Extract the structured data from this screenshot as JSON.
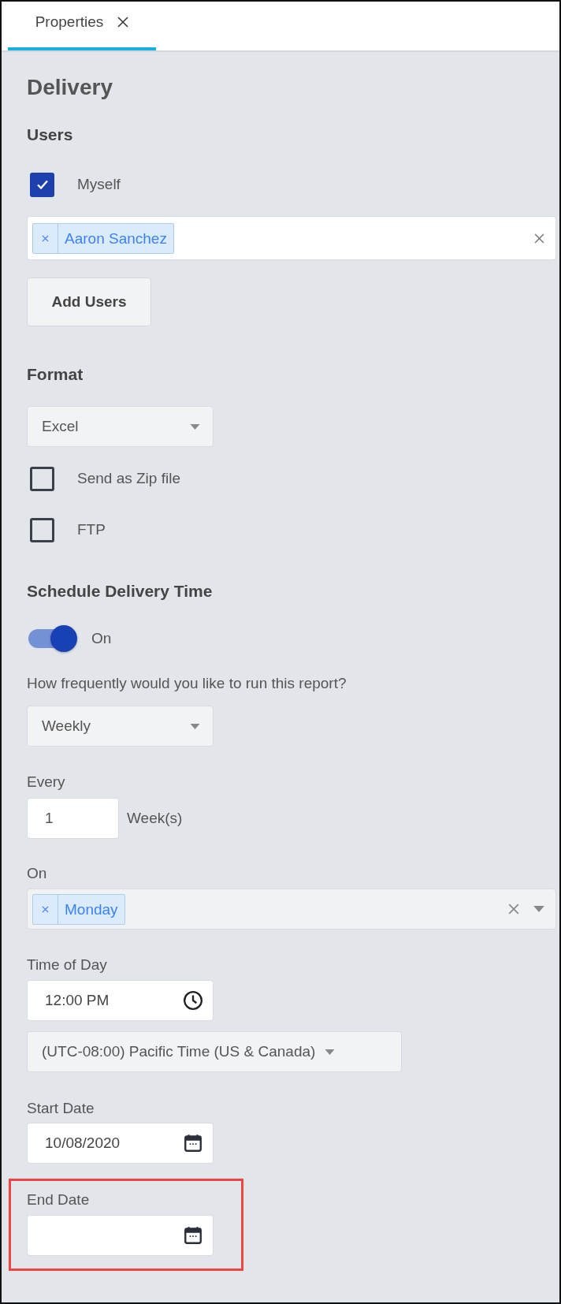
{
  "tabs": [
    {
      "label": "Properties",
      "selected": true
    }
  ],
  "title": "Delivery",
  "users": {
    "heading": "Users",
    "myself": {
      "label": "Myself",
      "checked": true
    },
    "recipients": [
      "Aaron Sanchez"
    ],
    "add_button": "Add Users"
  },
  "format": {
    "heading": "Format",
    "file_type": "Excel",
    "options": [
      {
        "label": "Send as Zip file",
        "checked": false
      },
      {
        "label": "FTP",
        "checked": false
      }
    ]
  },
  "schedule": {
    "heading": "Schedule Delivery Time",
    "toggle": {
      "label": "On",
      "on": true
    },
    "frequency_label": "How frequently would you like to run this report?",
    "frequency": "Weekly",
    "every_label": "Every",
    "every_value": "1",
    "every_unit": "Week(s)",
    "on_label": "On",
    "days": [
      "Monday"
    ],
    "time_label": "Time of Day",
    "time": "12:00 PM",
    "timezone": "(UTC-08:00) Pacific Time (US & Canada)",
    "start_label": "Start Date",
    "start_date": "10/08/2020",
    "end_label": "End Date",
    "end_highlighted": true
  }
}
